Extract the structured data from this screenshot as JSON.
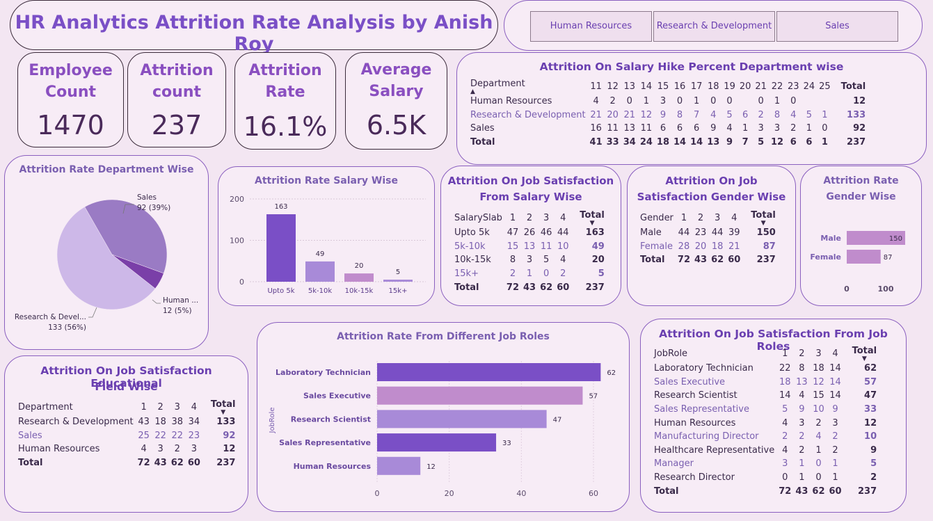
{
  "header": {
    "title": "HR Analytics Attrition Rate Analysis by Anish Roy"
  },
  "slicer": [
    "Human Resources",
    "Research & Development",
    "Sales"
  ],
  "kpis": [
    {
      "label1": "Employee",
      "label2": "Count",
      "value": "1470"
    },
    {
      "label1": "Attrition",
      "label2": "count",
      "value": "237"
    },
    {
      "label1": "Attrition",
      "label2": "Rate",
      "value": "16.1%"
    },
    {
      "label1": "Average",
      "label2": "Salary",
      "value": "6.5K"
    }
  ],
  "colors": {
    "dark_purple": "#7a4fc6",
    "light_purple": "#a88ad8",
    "pink_purple": "#c08ccc",
    "pale_purple": "#cdb8e8",
    "mid_purple": "#9a7bc4"
  },
  "salary_hike": {
    "title": "Attrition On Salary Hike Percent Department wise",
    "header": [
      "Department",
      "11",
      "12",
      "13",
      "14",
      "15",
      "16",
      "17",
      "18",
      "19",
      "20",
      "21",
      "22",
      "23",
      "24",
      "25",
      "Total"
    ],
    "rows": [
      [
        "Human Resources",
        "4",
        "2",
        "0",
        "1",
        "3",
        "0",
        "1",
        "0",
        "0",
        "",
        "0",
        "1",
        "0",
        "",
        "",
        "12"
      ],
      [
        "Research & Development",
        "21",
        "20",
        "21",
        "12",
        "9",
        "8",
        "7",
        "4",
        "5",
        "6",
        "2",
        "8",
        "4",
        "5",
        "1",
        "133"
      ],
      [
        "Sales",
        "16",
        "11",
        "13",
        "11",
        "6",
        "6",
        "6",
        "9",
        "4",
        "1",
        "3",
        "3",
        "2",
        "1",
        "0",
        "92"
      ],
      [
        "Total",
        "41",
        "33",
        "34",
        "24",
        "18",
        "14",
        "14",
        "13",
        "9",
        "7",
        "5",
        "12",
        "6",
        "6",
        "1",
        "237"
      ]
    ]
  },
  "chart_data": [
    {
      "type": "pie",
      "title": "Attrition Rate Department Wise",
      "slices": [
        {
          "name": "Sales",
          "value": 92,
          "label": "92 (39%)",
          "color": "#9a7bc4"
        },
        {
          "name": "Human ...",
          "value": 12,
          "label": "12 (5%)",
          "color": "#7a3fa8"
        },
        {
          "name": "Research & Devel...",
          "value": 133,
          "label": "133 (56%)",
          "color": "#cdb8e8"
        }
      ]
    },
    {
      "type": "bar",
      "title": "Attrition Rate Salary Wise",
      "categories": [
        "Upto 5k",
        "5k-10k",
        "10k-15k",
        "15k+"
      ],
      "values": [
        163,
        49,
        20,
        5
      ],
      "colors": [
        "#7a4fc6",
        "#a88ad8",
        "#c08ccc",
        "#a88ad8"
      ],
      "yticks": [
        "0",
        "100",
        "200"
      ],
      "ylim": [
        0,
        200
      ]
    },
    {
      "type": "bar",
      "title": "Attrition Rate Gender Wise",
      "categories": [
        "Male",
        "Female"
      ],
      "values": [
        150,
        87
      ],
      "xticks": [
        "0",
        "100"
      ],
      "xlim": [
        0,
        100
      ]
    },
    {
      "type": "bar",
      "title": "Attrition Rate From Different Job Roles",
      "ylabel": "JobRole",
      "categories": [
        "Laboratory Technician",
        "Sales Executive",
        "Research Scientist",
        "Sales Representative",
        "Human Resources"
      ],
      "values": [
        62,
        57,
        47,
        33,
        12
      ],
      "colors": [
        "#7a4fc6",
        "#c08ccc",
        "#a88ad8",
        "#7a4fc6",
        "#a88ad8"
      ],
      "xticks": [
        "0",
        "20",
        "40",
        "60"
      ],
      "xlim": [
        0,
        62
      ]
    }
  ],
  "salary_sat": {
    "title1": "Attrition On Job Satisfaction",
    "title2": "From Salary Wise",
    "header": [
      "SalarySlab",
      "1",
      "2",
      "3",
      "4",
      "Total"
    ],
    "rows": [
      [
        "Upto 5k",
        "47",
        "26",
        "46",
        "44",
        "163"
      ],
      [
        "5k-10k",
        "15",
        "13",
        "11",
        "10",
        "49"
      ],
      [
        "10k-15k",
        "8",
        "3",
        "5",
        "4",
        "20"
      ],
      [
        "15k+",
        "2",
        "1",
        "0",
        "2",
        "5"
      ],
      [
        "Total",
        "72",
        "43",
        "62",
        "60",
        "237"
      ]
    ]
  },
  "gender_sat": {
    "title1": "Attrition On Job",
    "title2": "Satisfaction Gender Wise",
    "header": [
      "Gender",
      "1",
      "2",
      "3",
      "4",
      "Total"
    ],
    "rows": [
      [
        "Male",
        "44",
        "23",
        "44",
        "39",
        "150"
      ],
      [
        "Female",
        "28",
        "20",
        "18",
        "21",
        "87"
      ],
      [
        "Total",
        "72",
        "43",
        "62",
        "60",
        "237"
      ]
    ]
  },
  "gender_chart": {
    "title1": "Attrition Rate",
    "title2": "Gender Wise"
  },
  "edu_sat": {
    "title1": "Attrition On Job Satisfaction Educational",
    "title2": "Field Wise",
    "header": [
      "Department",
      "1",
      "2",
      "3",
      "4",
      "Total"
    ],
    "rows": [
      [
        "Research & Development",
        "43",
        "18",
        "38",
        "34",
        "133"
      ],
      [
        "Sales",
        "25",
        "22",
        "22",
        "23",
        "92"
      ],
      [
        "Human Resources",
        "4",
        "3",
        "2",
        "3",
        "12"
      ],
      [
        "Total",
        "72",
        "43",
        "62",
        "60",
        "237"
      ]
    ]
  },
  "jobrole_sat": {
    "title": "Attrition On Job Satisfaction From Job Roles",
    "header": [
      "JobRole",
      "1",
      "2",
      "3",
      "4",
      "Total"
    ],
    "rows": [
      [
        "Laboratory Technician",
        "22",
        "8",
        "18",
        "14",
        "62"
      ],
      [
        "Sales Executive",
        "18",
        "13",
        "12",
        "14",
        "57"
      ],
      [
        "Research Scientist",
        "14",
        "4",
        "15",
        "14",
        "47"
      ],
      [
        "Sales Representative",
        "5",
        "9",
        "10",
        "9",
        "33"
      ],
      [
        "Human Resources",
        "4",
        "3",
        "2",
        "3",
        "12"
      ],
      [
        "Manufacturing Director",
        "2",
        "2",
        "4",
        "2",
        "10"
      ],
      [
        "Healthcare Representative",
        "4",
        "2",
        "1",
        "2",
        "9"
      ],
      [
        "Manager",
        "3",
        "1",
        "0",
        "1",
        "5"
      ],
      [
        "Research Director",
        "0",
        "1",
        "0",
        "1",
        "2"
      ],
      [
        "Total",
        "72",
        "43",
        "62",
        "60",
        "237"
      ]
    ]
  }
}
